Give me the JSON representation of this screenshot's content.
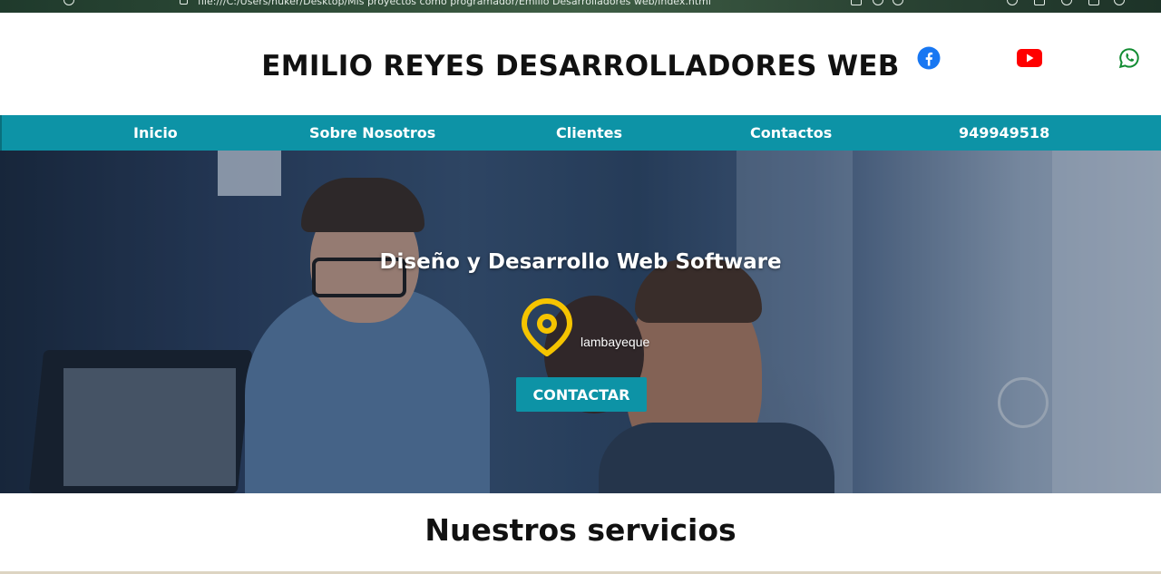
{
  "browser": {
    "url": "file:///C:/Users/nuker/Desktop/Mis proyectos como programador/Emilio Desarrolladores web/index.html"
  },
  "header": {
    "title": "EMILIO REYES DESARROLLADORES WEB",
    "social": [
      {
        "name": "facebook-icon",
        "color": "#1877f2"
      },
      {
        "name": "youtube-icon",
        "color": "#ff0000"
      },
      {
        "name": "whatsapp-icon",
        "color": "#128c32"
      }
    ]
  },
  "nav": {
    "items": [
      {
        "label": "Inicio"
      },
      {
        "label": "Sobre Nosotros"
      },
      {
        "label": "Clientes"
      },
      {
        "label": "Contactos"
      },
      {
        "label": "949949518"
      }
    ],
    "color": "#0d93a6"
  },
  "hero": {
    "title": "Diseño y Desarrollo Web Software",
    "location": "lambayeque",
    "pin_color": "#f5c400",
    "cta_label": "CONTACTAR"
  },
  "services": {
    "title": "Nuestros servicios"
  }
}
